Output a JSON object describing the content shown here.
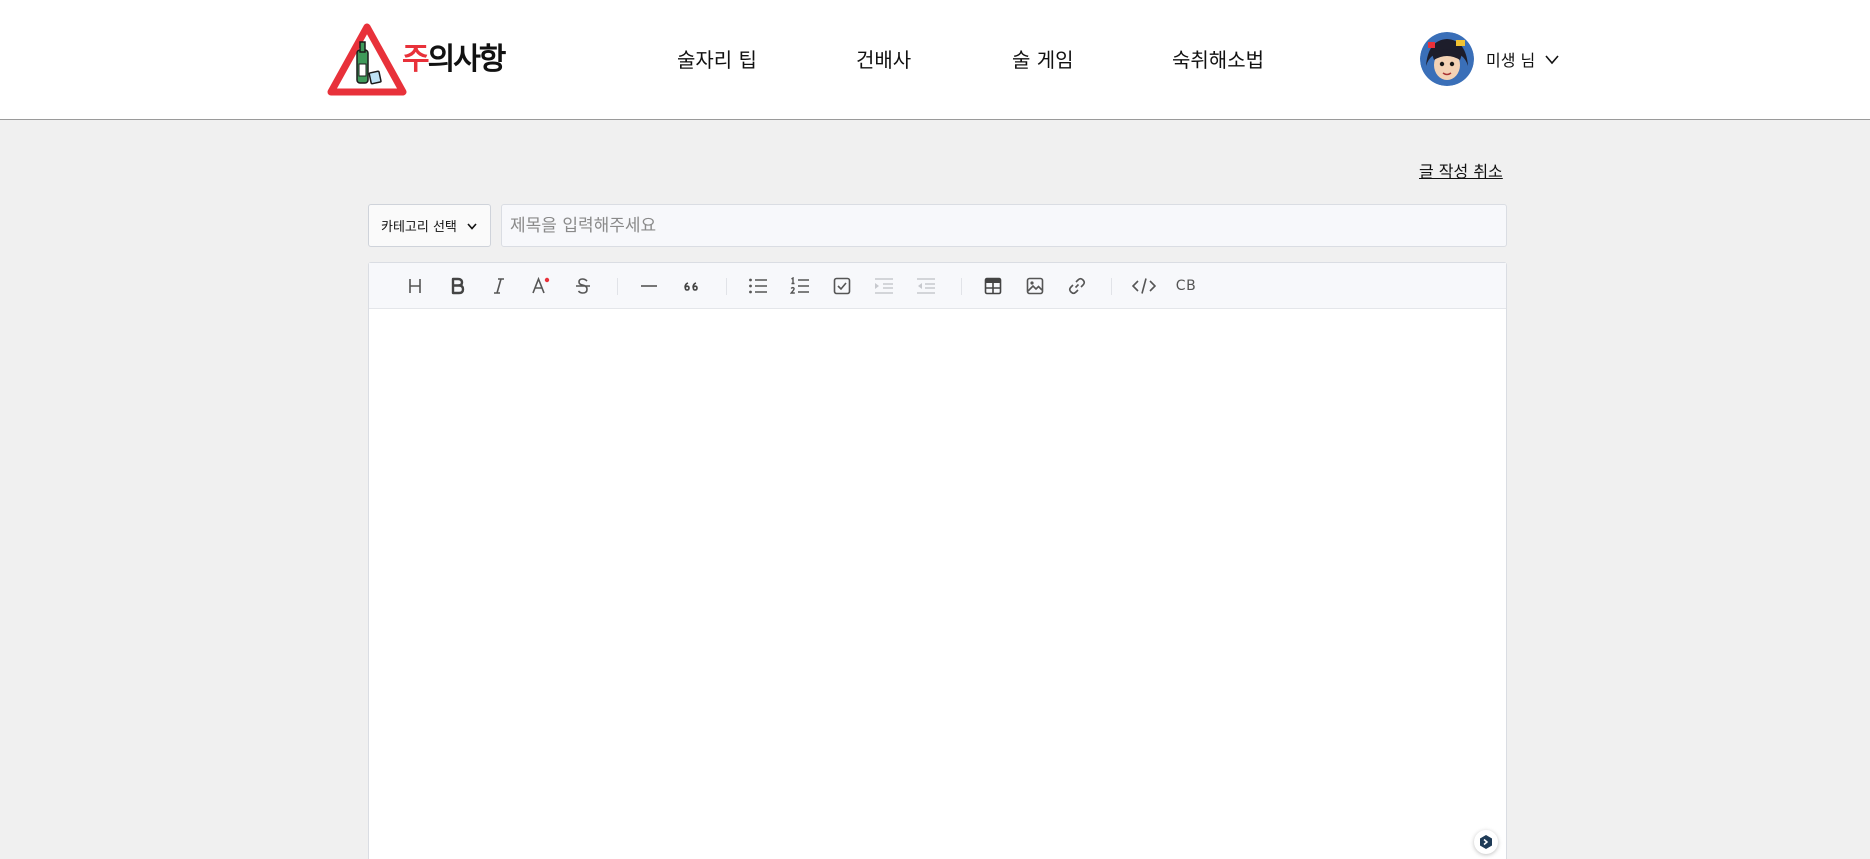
{
  "header": {
    "logo": {
      "text_accent": "주",
      "text_rest": "의사항"
    },
    "nav": [
      {
        "label": "술자리 팁"
      },
      {
        "label": "건배사"
      },
      {
        "label": "술 게임"
      },
      {
        "label": "숙취해소법"
      }
    ],
    "user": {
      "name": "미생 님"
    }
  },
  "cancel_label": "글 작성 취소",
  "category_select": {
    "selected": "카테고리 선택"
  },
  "title_input": {
    "value": "",
    "placeholder": "제목을 입력해주세요"
  },
  "toolbar": {
    "codeblock_label": "CB",
    "icons": [
      "heading",
      "bold",
      "italic",
      "text-color",
      "strikethrough",
      "horizontal-rule",
      "quote",
      "bullet-list",
      "ordered-list",
      "task-list",
      "indent",
      "outdent",
      "table",
      "image",
      "link",
      "code",
      "codeblock"
    ]
  },
  "colors": {
    "brand_red": "#e8313a",
    "background": "#f0f0f0",
    "toolbar_bg": "#f7f8fb"
  }
}
